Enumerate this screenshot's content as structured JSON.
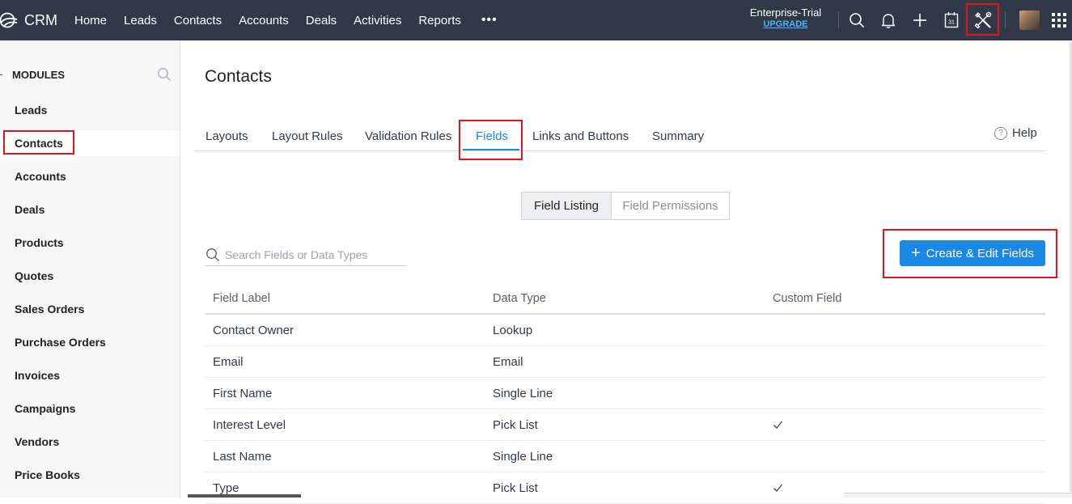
{
  "app": {
    "logo_text": "CRM",
    "nav": [
      "Home",
      "Leads",
      "Contacts",
      "Accounts",
      "Deals",
      "Activities",
      "Reports"
    ],
    "more_label": "•••",
    "edition": "Enterprise-Trial",
    "upgrade": "UPGRADE",
    "icons": [
      "search-icon",
      "bell-icon",
      "plus-icon",
      "calendar-icon",
      "setup-tools-icon",
      "avatar",
      "apps-grid-icon"
    ],
    "calendar_day": "31"
  },
  "sidebar": {
    "heading": "MODULES",
    "items": [
      "Leads",
      "Contacts",
      "Accounts",
      "Deals",
      "Products",
      "Quotes",
      "Sales Orders",
      "Purchase Orders",
      "Invoices",
      "Campaigns",
      "Vendors",
      "Price Books"
    ],
    "active": "Contacts"
  },
  "main": {
    "title": "Contacts",
    "tabs": [
      "Layouts",
      "Layout Rules",
      "Validation Rules",
      "Fields",
      "Links and Buttons",
      "Summary"
    ],
    "active_tab": "Fields",
    "help_label": "Help",
    "segments": [
      "Field Listing",
      "Field Permissions"
    ],
    "active_segment": "Field Listing",
    "search_placeholder": "Search Fields or Data Types",
    "create_button": "Create & Edit Fields",
    "columns": [
      "Field Label",
      "Data Type",
      "Custom Field"
    ],
    "rows": [
      {
        "label": "Contact Owner",
        "type": "Lookup",
        "custom": false
      },
      {
        "label": "Email",
        "type": "Email",
        "custom": false
      },
      {
        "label": "First Name",
        "type": "Single Line",
        "custom": false
      },
      {
        "label": "Interest Level",
        "type": "Pick List",
        "custom": true
      },
      {
        "label": "Last Name",
        "type": "Single Line",
        "custom": false
      },
      {
        "label": "Type",
        "type": "Pick List",
        "custom": true
      }
    ]
  },
  "colors": {
    "topbar": "#313949",
    "accent": "#1b88e7",
    "highlight": "#e0141d"
  }
}
